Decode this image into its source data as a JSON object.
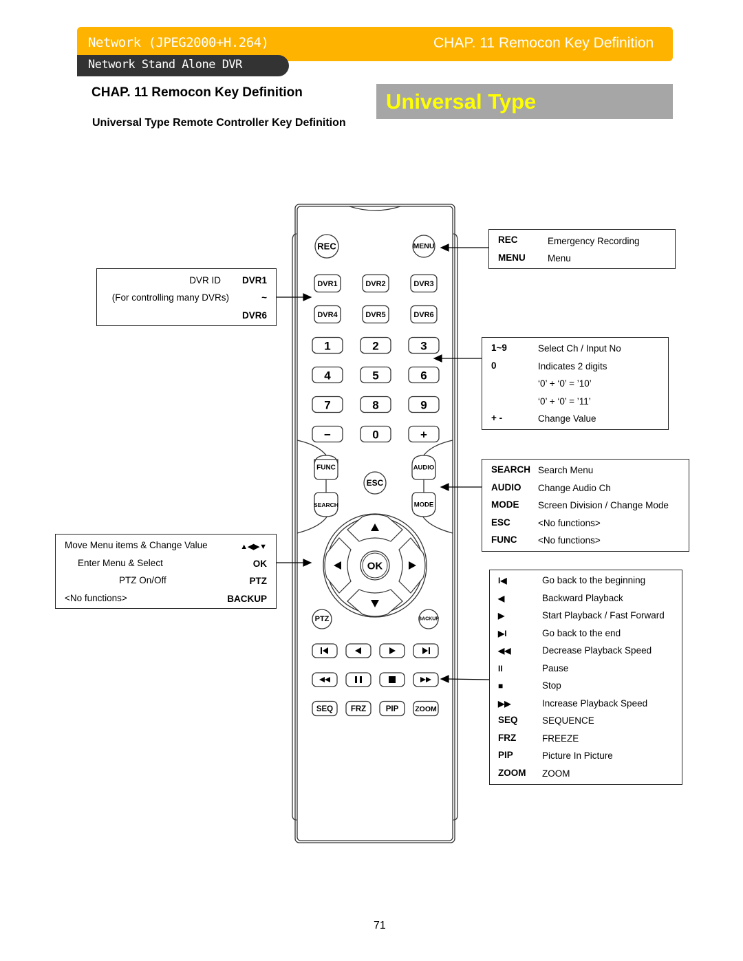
{
  "header": {
    "product": "Network (JPEG2000+H.264)",
    "chapter": "CHAP. 11  Remocon Key Definition",
    "subtitle": "Network Stand Alone DVR",
    "bar_color": "#FEB300",
    "sub_color": "#333333"
  },
  "page": {
    "chapter_title": "CHAP. 11   Remocon Key Definition",
    "section_title": "Universal Type Remote Controller Key Definition",
    "type_banner": "Universal Type",
    "banner_color": "#A6A6A6",
    "banner_text_color": "#FFFF00",
    "page_number": "71"
  },
  "remote": {
    "rec": "REC",
    "menu": "MENU",
    "dvr_buttons": [
      "DVR1",
      "DVR2",
      "DVR3",
      "DVR4",
      "DVR5",
      "DVR6"
    ],
    "number_buttons": [
      "1",
      "2",
      "3",
      "4",
      "5",
      "6",
      "7",
      "8",
      "9",
      "−",
      "0",
      "+"
    ],
    "func": "FUNC",
    "audio": "AUDIO",
    "esc": "ESC",
    "search": "SEARCH",
    "mode": "MODE",
    "ok": "OK",
    "ptz": "PTZ",
    "backup": "BACKUP",
    "playback_icons": [
      "skip-back-icon",
      "rewind-play-icon",
      "play-icon",
      "skip-end-icon"
    ],
    "speed_icons": [
      "fast-rewind-icon",
      "pause-icon",
      "stop-icon",
      "fast-forward-icon"
    ],
    "bottom_buttons": [
      "SEQ",
      "FRZ",
      "PIP",
      "ZOOM"
    ]
  },
  "legend_rec_menu": [
    {
      "key": "REC",
      "desc": "Emergency Recording"
    },
    {
      "key": "MENU",
      "desc": "Menu"
    }
  ],
  "legend_dvr": {
    "label": "DVR ID",
    "note": "(For controlling many DVRs)",
    "from": "DVR1",
    "tilde": "~",
    "to": "DVR6"
  },
  "legend_numbers": [
    {
      "key": "1~9",
      "desc": "Select Ch /  Input No"
    },
    {
      "key": "0",
      "desc": "Indicates 2 digits"
    },
    {
      "key": "",
      "desc": "‘0’ + ‘0’ = ’10’"
    },
    {
      "key": "",
      "desc": "‘0’ + ‘0’ = ’11’"
    },
    {
      "key": "+ -",
      "desc": "Change Value"
    }
  ],
  "legend_func": [
    {
      "key": "SEARCH",
      "desc": "Search Menu"
    },
    {
      "key": "AUDIO",
      "desc": "Change Audio Ch"
    },
    {
      "key": "MODE",
      "desc": "Screen Division / Change Mode"
    },
    {
      "key": "ESC",
      "desc": "<No functions>"
    },
    {
      "key": "FUNC",
      "desc": " <No functions>"
    }
  ],
  "legend_nav": [
    {
      "desc": "Move Menu items & Change Value",
      "key": "▲◀▶▼"
    },
    {
      "desc": "Enter Menu & Select",
      "key": "OK"
    },
    {
      "desc": "PTZ On/Off",
      "key": "PTZ"
    },
    {
      "desc": "<No functions>",
      "key": "BACKUP"
    }
  ],
  "legend_playback": [
    {
      "key": "I◀",
      "icon": "skip-back-icon",
      "desc": "Go back to the beginning"
    },
    {
      "key": "◀",
      "icon": "backward-icon",
      "desc": "Backward Playback"
    },
    {
      "key": "▶",
      "icon": "play-icon",
      "desc": "Start Playback / Fast Forward"
    },
    {
      "key": "▶I",
      "icon": "skip-end-icon",
      "desc": "Go back to the end"
    },
    {
      "key": "◀◀",
      "icon": "fast-rewind-icon",
      "desc": "Decrease Playback Speed"
    },
    {
      "key": "II",
      "icon": "pause-icon",
      "desc": "Pause"
    },
    {
      "key": "■",
      "icon": "stop-icon",
      "desc": "Stop"
    },
    {
      "key": "▶▶",
      "icon": "fast-forward-icon",
      "desc": "Increase Playback Speed"
    },
    {
      "key": "SEQ",
      "icon": "",
      "desc": "SEQUENCE"
    },
    {
      "key": "FRZ",
      "icon": "",
      "desc": "FREEZE"
    },
    {
      "key": "PIP",
      "icon": "",
      "desc": "Picture In Picture"
    },
    {
      "key": "ZOOM",
      "icon": "",
      "desc": "ZOOM"
    }
  ]
}
